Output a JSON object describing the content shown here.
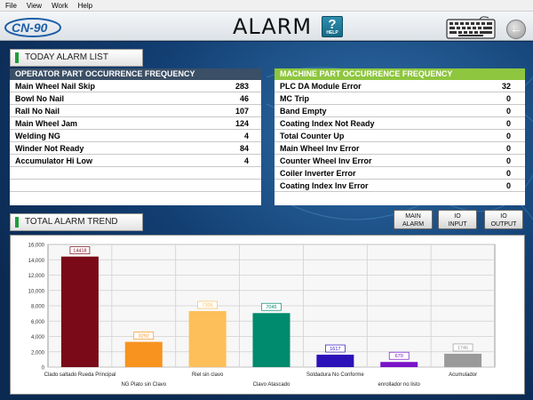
{
  "menu": [
    "File",
    "View",
    "Work",
    "Help"
  ],
  "header": {
    "title": "ALARM",
    "logo": "CN-90",
    "help_label": "HELP"
  },
  "today_section": "TODAY ALARM LIST",
  "trend_section": "TOTAL ALARM TREND",
  "operator": {
    "title": "OPERATOR PART OCCURRENCE FREQUENCY",
    "rows": [
      {
        "label": "Main Wheel Nail Skip",
        "value": "283"
      },
      {
        "label": "Bowl No Nail",
        "value": "46"
      },
      {
        "label": "Rall No Nail",
        "value": "107"
      },
      {
        "label": "Main Wheel Jam",
        "value": "124"
      },
      {
        "label": "Welding NG",
        "value": "4"
      },
      {
        "label": "Winder Not Ready",
        "value": "84"
      },
      {
        "label": "Accumulator Hi Low",
        "value": "4"
      },
      {
        "label": "",
        "value": ""
      },
      {
        "label": "",
        "value": ""
      }
    ]
  },
  "machine": {
    "title": "MACHINE PART OCCURRENCE FREQUENCY",
    "rows": [
      {
        "label": "PLC DA Module Error",
        "value": "32"
      },
      {
        "label": "MC Trip",
        "value": "0"
      },
      {
        "label": "Band Empty",
        "value": "0"
      },
      {
        "label": "Coating Index Not Ready",
        "value": "0"
      },
      {
        "label": "Total Counter Up",
        "value": "0"
      },
      {
        "label": "Main Wheel Inv Error",
        "value": "0"
      },
      {
        "label": "Counter Wheel Inv Error",
        "value": "0"
      },
      {
        "label": "Coiler Inverter Error",
        "value": "0"
      },
      {
        "label": "Coating Index Inv Error",
        "value": "0"
      }
    ]
  },
  "buttons": [
    {
      "line1": "MAIN",
      "line2": "ALARM"
    },
    {
      "line1": "IO",
      "line2": "INPUT"
    },
    {
      "line1": "IO",
      "line2": "OUTPUT"
    }
  ],
  "icons": {
    "help": "help-icon",
    "keyboard": "keyboard-icon",
    "back": "back-arrow-icon"
  },
  "chart_data": {
    "type": "bar",
    "categories": [
      "Clado saltado Rueda Principal",
      "NG Plato sin Clavo",
      "Riel sin clavo",
      "Clavo Atascado",
      "Soldadura No Conforme",
      "enrollador no listo",
      "Acumulador"
    ],
    "values": [
      14418,
      3292,
      7305,
      7045,
      1617,
      670,
      1746
    ],
    "colors": [
      "#7a0a17",
      "#f7931e",
      "#fdbf5a",
      "#008a6e",
      "#2a12b8",
      "#7a12c8",
      "#9a9a9a"
    ],
    "yticks": [
      "0",
      "2,000",
      "4,000",
      "6,000",
      "8,000",
      "10,000",
      "12,000",
      "14,000",
      "16,000"
    ],
    "ylim": [
      0,
      16000
    ],
    "grid": true
  }
}
